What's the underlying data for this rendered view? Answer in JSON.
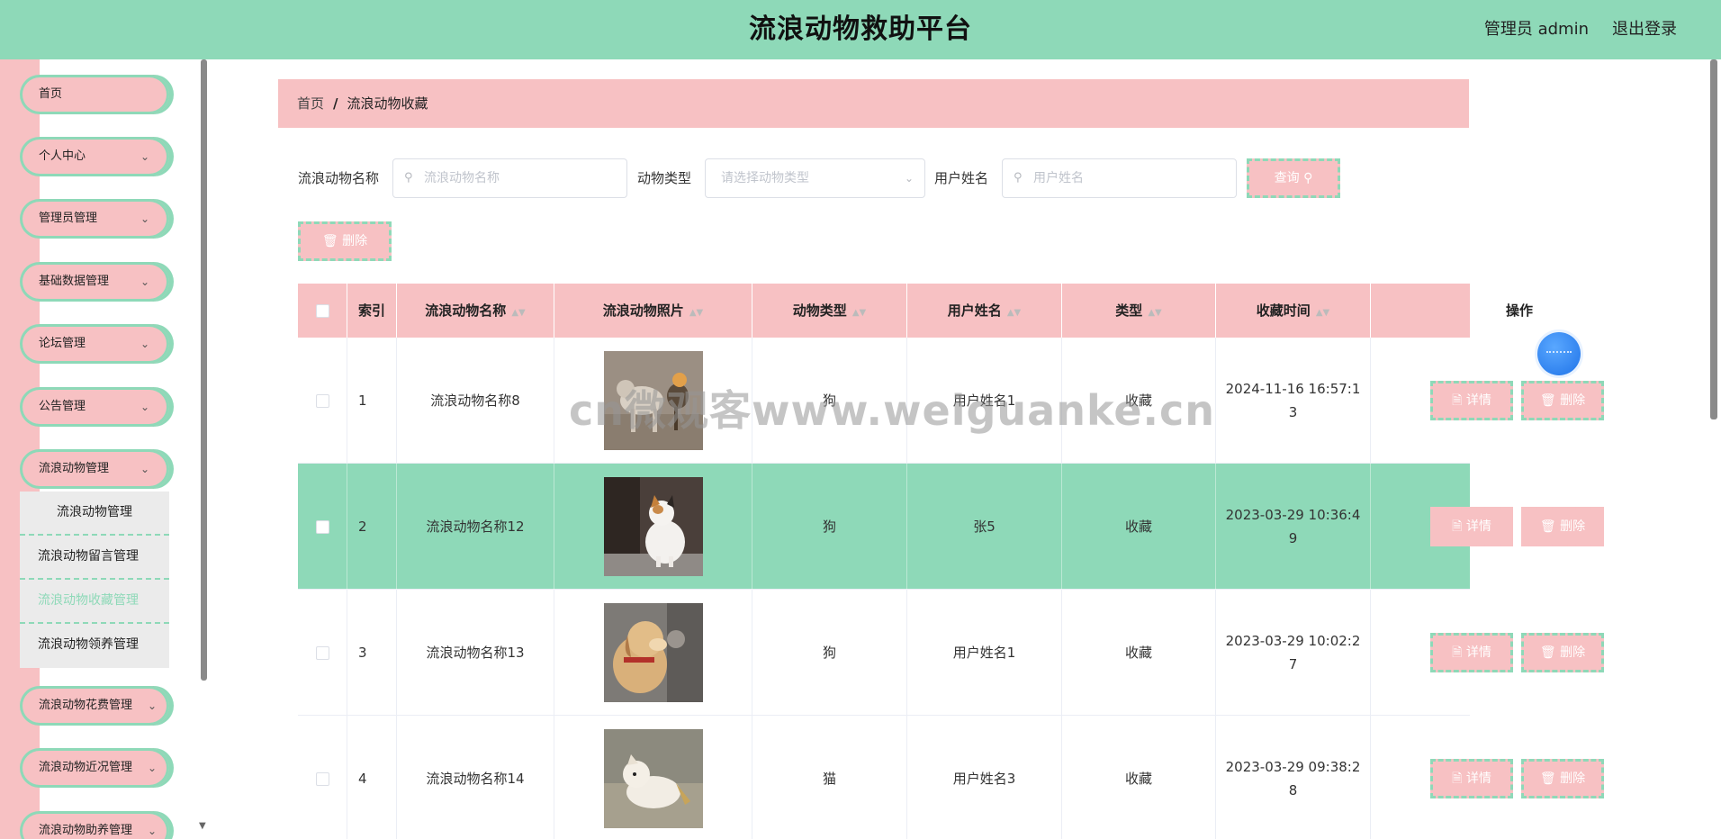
{
  "header": {
    "title": "流浪动物救助平台",
    "user": "管理员 admin",
    "logout": "退出登录"
  },
  "sidebar": {
    "items": [
      {
        "label": "首页",
        "expandable": false
      },
      {
        "label": "个人中心",
        "expandable": true
      },
      {
        "label": "管理员管理",
        "expandable": true
      },
      {
        "label": "基础数据管理",
        "expandable": true
      },
      {
        "label": "论坛管理",
        "expandable": true
      },
      {
        "label": "公告管理",
        "expandable": true
      },
      {
        "label": "流浪动物管理",
        "expandable": true
      },
      {
        "label": "流浪动物花费管理",
        "expandable": true
      },
      {
        "label": "流浪动物近况管理",
        "expandable": true
      },
      {
        "label": "流浪动物助养管理",
        "expandable": true
      }
    ],
    "submenu": [
      {
        "label": "流浪动物管理"
      },
      {
        "label": "流浪动物留言管理"
      },
      {
        "label": "流浪动物收藏管理"
      },
      {
        "label": "流浪动物领养管理"
      }
    ],
    "active_submenu": "流浪动物收藏管理"
  },
  "breadcrumb": {
    "home": "首页",
    "separator": "/",
    "current": "流浪动物收藏"
  },
  "search": {
    "name_label": "流浪动物名称",
    "name_placeholder": "流浪动物名称",
    "type_label": "动物类型",
    "type_placeholder": "请选择动物类型",
    "user_label": "用户姓名",
    "user_placeholder": "用户姓名",
    "query_button": "查询",
    "delete_button": "删除"
  },
  "table": {
    "columns": [
      "索引",
      "流浪动物名称",
      "流浪动物照片",
      "动物类型",
      "用户姓名",
      "类型",
      "收藏时间",
      "操作"
    ],
    "rows": [
      {
        "index": "1",
        "name": "流浪动物名称8",
        "animal_type": "狗",
        "user": "用户姓名1",
        "type": "收藏",
        "time_line1": "2024-11-16 16:57:1",
        "time_line2": "3",
        "photo": "dog-cat-photo"
      },
      {
        "index": "2",
        "name": "流浪动物名称12",
        "animal_type": "狗",
        "user": "张5",
        "type": "收藏",
        "time_line1": "2023-03-29 10:36:4",
        "time_line2": "9",
        "photo": "cat-photo"
      },
      {
        "index": "3",
        "name": "流浪动物名称13",
        "animal_type": "狗",
        "user": "用户姓名1",
        "type": "收藏",
        "time_line1": "2023-03-29 10:02:2",
        "time_line2": "7",
        "photo": "dog-photo"
      },
      {
        "index": "4",
        "name": "流浪动物名称14",
        "animal_type": "猫",
        "user": "用户姓名3",
        "type": "收藏",
        "time_line1": "2023-03-29 09:38:2",
        "time_line2": "8",
        "photo": "puppy-photo"
      }
    ],
    "detail_button": "详情",
    "delete_button": "删除"
  },
  "watermark": "cn微观客www.weiguanke.cn",
  "colors": {
    "header_green": "#8ed9b8",
    "accent_pink": "#f7c1c3",
    "highlight_row": "#8ed9b8"
  }
}
